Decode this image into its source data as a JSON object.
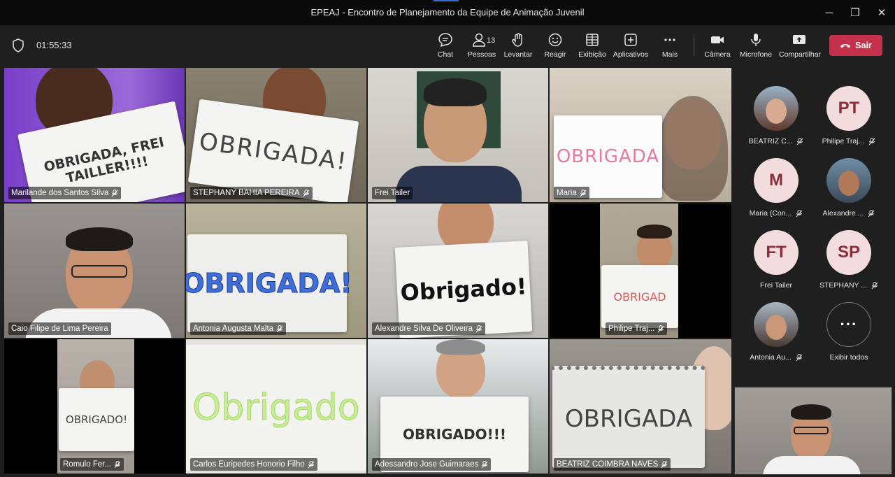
{
  "window": {
    "title": "EPEAJ - Encontro de Planejamento da Equipe de Animação Juvenil",
    "controls": {
      "minimize": "─",
      "maximize": "❐",
      "close": "✕"
    }
  },
  "toolbar": {
    "timer": "01:55:33",
    "chat": "Chat",
    "people": "Pessoas",
    "people_count": "13",
    "raise": "Levantar",
    "react": "Reagir",
    "view": "Exibição",
    "apps": "Aplicativos",
    "more": "Mais",
    "camera": "Câmera",
    "mic": "Microfone",
    "share": "Compartilhar",
    "leave": "Sair"
  },
  "tiles": [
    {
      "name": "Marilande dos Santos Silva",
      "sign": "OBRIGADA, FREI TAILLER!!!!"
    },
    {
      "name": "STEPHANY BAHIA PEREIRA",
      "sign": "OBRIGADA!"
    },
    {
      "name": "Frei Tailer"
    },
    {
      "name": "Maria",
      "sign": "OBRIGADA"
    },
    {
      "name": "Caio Filipe de Lima Pereira"
    },
    {
      "name": "Antonia Augusta Malta",
      "sign": "OBRIGADA!"
    },
    {
      "name": "Alexandre Silva De Oliveira",
      "sign": "Obrigado!"
    },
    {
      "name": "Philipe Traj...",
      "sign": "OBRIGAD"
    },
    {
      "name": "Romulo Fer...",
      "sign": "OBRIGADO!"
    },
    {
      "name": "Carlos Euripedes Honorio Filho",
      "sign": "Obrigado"
    },
    {
      "name": "Adessandro Jose Guimaraes",
      "sign": "OBRIGADO!!!"
    },
    {
      "name": "BEATRIZ COIMBRA NAVES",
      "sign": "OBRIGADA"
    }
  ],
  "roster": [
    {
      "name": "BEATRIZ C...",
      "initials": ""
    },
    {
      "name": "Philipe Traj...",
      "initials": "PT"
    },
    {
      "name": "Maria (Con...",
      "initials": "M"
    },
    {
      "name": "Alexandre ...",
      "initials": ""
    },
    {
      "name": "Frei Tailer",
      "initials": "FT"
    },
    {
      "name": "STEPHANY ...",
      "initials": "SP"
    },
    {
      "name": "Antonia Au...",
      "initials": ""
    },
    {
      "name": "Exibir todos",
      "initials": "···"
    }
  ],
  "icons": {
    "shield": "shield-icon",
    "mic_off": "mic-off-icon"
  },
  "colors": {
    "leave": "#c4314b",
    "avatar_bg": "#f3dcde",
    "avatar_text": "#8a2e3b"
  }
}
